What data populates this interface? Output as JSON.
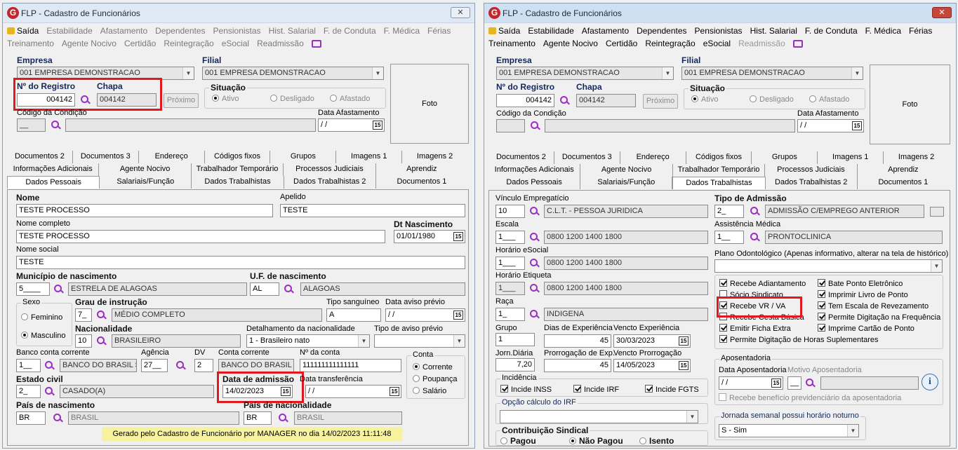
{
  "title": "FLP - Cadastro de Funcionários",
  "logo": "G",
  "close": "✕",
  "menu1": [
    "Saída",
    "Estabilidade",
    "Afastamento",
    "Dependentes",
    "Pensionistas",
    "Hist. Salarial",
    "F. de Conduta",
    "F. Médica",
    "Férias"
  ],
  "menu2": [
    "Treinamento",
    "Agente Nocivo",
    "Certidão",
    "Reintegração",
    "eSocial",
    "Readmissão"
  ],
  "hdr": {
    "empresa_l": "Empresa",
    "empresa": "001 EMPRESA DEMONSTRACAO",
    "filial_l": "Filial",
    "filial": "001 EMPRESA DEMONSTRACAO",
    "registro_l": "Nº do Registro",
    "registro": "004142",
    "chapa_l": "Chapa",
    "chapa": "004142",
    "proximo": "Próximo",
    "situacao_l": "Situação",
    "ativo": "Ativo",
    "desligado": "Desligado",
    "afastado": "Afastado",
    "foto": "Foto",
    "cod_cond_l": "Código da Condição",
    "cod_cond": "__",
    "data_af_l": "Data Afastamento",
    "data_af": " / /",
    "cal": "15"
  },
  "tabs1": [
    "Documentos 2",
    "Documentos 3",
    "Endereço",
    "Códigos fixos",
    "Grupos",
    "Imagens 1",
    "Imagens 2"
  ],
  "tabs2": [
    "Informações Adicionais",
    "Agente Nocivo",
    "Trabalhador Temporário",
    "Processos Judiciais",
    "Aprendiz"
  ],
  "tabs3": [
    "Dados Pessoais",
    "Salariais/Função",
    "Dados Trabalhistas",
    "Dados Trabalhistas 2",
    "Documentos 1"
  ],
  "left": {
    "nome_l": "Nome",
    "nome": "TESTE PROCESSO",
    "apelido_l": "Apelido",
    "apelido": "TESTE",
    "nomec_l": "Nome completo",
    "nomec": "TESTE PROCESSO",
    "dtnasc_l": "Dt Nascimento",
    "dtnasc": "01/01/1980",
    "nomes_l": "Nome social",
    "nomes": "TESTE",
    "mun_l": "Município de nascimento",
    "mun_cod": "5____",
    "mun": "ESTRELA DE ALAGOAS",
    "uf_l": "U.F. de nascimento",
    "uf": "AL",
    "uf_nome": "ALAGOAS",
    "sexo_l": "Sexo",
    "fem": "Feminino",
    "masc": "Masculino",
    "grau_l": "Grau de instrução",
    "grau_cod": "7_",
    "grau": "MÉDIO COMPLETO",
    "sangue_l": "Tipo sanguíneo",
    "sangue": "A",
    "aviso_l": "Data aviso prévio",
    "aviso": " / /",
    "nac_l": "Nacionalidade",
    "nac_cod": "10",
    "nac": "BRASILEIRO",
    "det_l": "Detalhamento da nacionalidade",
    "det": "1 - Brasileiro nato",
    "tipoav_l": "Tipo de aviso prévio",
    "tipoav": "",
    "banco_l": "Banco conta corrente",
    "banco_cod": "1__",
    "banco": "BANCO DO BRASIL S",
    "ag_l": "Agência",
    "ag": "27__",
    "dv_l": "DV",
    "dv": "2",
    "conta_l": "Conta corrente",
    "conta": "BANCO DO BRASIL /",
    "nconta_l": "Nº da conta",
    "nconta": "111111111111111",
    "tconta_l": "Conta",
    "corrente": "Corrente",
    "poupanca": "Poupança",
    "salario": "Salário",
    "civil_l": "Estado civil",
    "civil_cod": "2_",
    "civil": "CASADO(A)",
    "adm_l": "Data de admissão",
    "adm": "14/02/2023",
    "transf_l": "Data transferência",
    "transf": " / /",
    "pais_l": "País de nascimento",
    "pais_cod": "BR",
    "pais": "BRASIL",
    "paisn_l": "País de nacionalidade",
    "paisn_cod": "BR",
    "paisn": "BRASIL",
    "footer": "Gerado pelo Cadastro de Funcionário por MANAGER no dia 14/02/2023 11:11:48"
  },
  "right": {
    "vinc_l": "Vínculo Empregatício",
    "vinc_cod": "10",
    "vinc": "C.L.T. - PESSOA JURIDICA",
    "tadm_l": "Tipo de Admissão",
    "tadm_cod": "2_",
    "tadm": "ADMISSÃO C/EMPREGO ANTERIOR",
    "escala_l": "Escala",
    "escala_cod": "1___",
    "escala": "0800 1200 1400 1800",
    "assist_l": "Assistência Médica",
    "assist_cod": "1__",
    "assist": "PRONTOCLINICA",
    "hes_l": "Horário eSocial",
    "hes_cod": "1___",
    "hes": "0800 1200 1400 1800",
    "plano_l": "Plano Odontológico (Apenas informativo, alterar na tela de histórico)",
    "het_l": "Horário Etiqueta",
    "het_cod": "1___",
    "het": "0800 1200 1400 1800",
    "raca_l": "Raça",
    "raca_cod": "1_",
    "raca": "INDIGENA",
    "grupo_l": "Grupo",
    "grupo": "1",
    "diasexp_l": "Dias de Experiência",
    "diasexp": "45",
    "vexp_l": "Vencto Experiência",
    "vexp": "30/03/2023",
    "jorn_l": "Jorn.Diária",
    "jorn": "7,20",
    "prorr_l": "Prorrogação de Exp.",
    "prorr": "45",
    "vprorr_l": "Vencto Prorrogação",
    "vprorr": "14/05/2023",
    "chk": [
      "Recebe Adiantamento",
      "Sócio Sindicato",
      "Recebe VR / VA",
      "Recebe Cesta Básica",
      "Emitir Ficha Extra",
      "Permite Digitação de Horas Suplementares"
    ],
    "chk2": [
      "Bate Ponto Eletrônico",
      "Imprimir Livro de Ponto",
      "Tem Escala de Revezamento",
      "Permite Digitação na Frequência",
      "Imprime Cartão de Ponto"
    ],
    "inc_l": "Incidência",
    "inss": "Incide INSS",
    "irf": "Incide IRF",
    "fgts": "Incide FGTS",
    "opirf_l": "Opção cálculo do IRF",
    "contrib_l": "Contribuição Sindical",
    "pagou": "Pagou",
    "naopagou": "Não Pagou",
    "isento": "Isento",
    "apos_l": "Aposentadoria",
    "dapos_l": "Data Aposentadoria",
    "mapos_l": "Motivo Aposentadoria",
    "dapos": " / /",
    "mapos": "__",
    "rbp": "Recebe benefício previdenciário da aposentadoria",
    "jorn_not_l": "Jornada semanal possui horário noturno",
    "jorn_not": "S - Sim",
    "info": "i"
  }
}
